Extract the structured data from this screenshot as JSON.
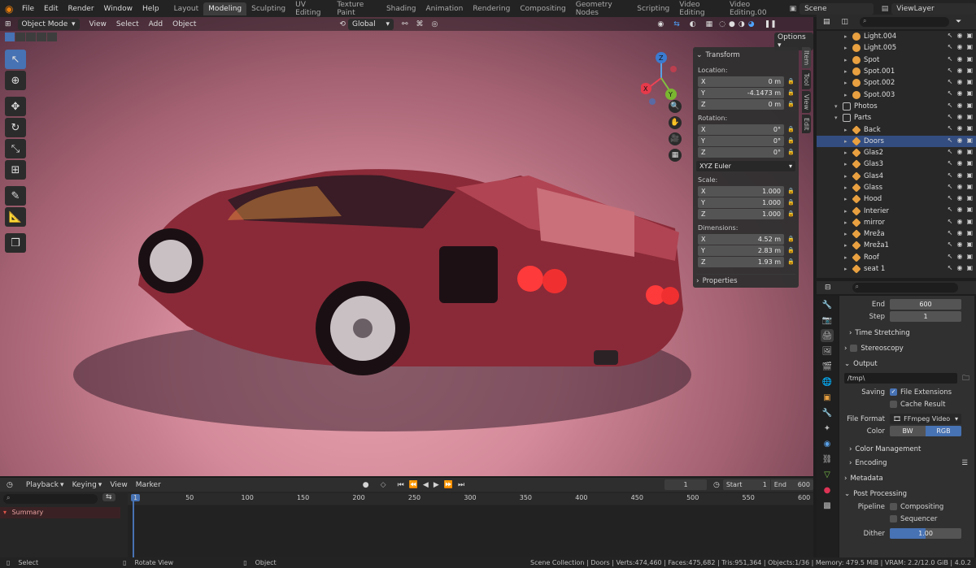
{
  "app": {
    "menu": [
      "File",
      "Edit",
      "Render",
      "Window",
      "Help"
    ],
    "workspaces": [
      "Layout",
      "Modeling",
      "Sculpting",
      "UV Editing",
      "Texture Paint",
      "Shading",
      "Animation",
      "Rendering",
      "Compositing",
      "Geometry Nodes",
      "Scripting",
      "Video Editing",
      "Video Editing.00"
    ],
    "active_workspace": "Modeling",
    "scene": "Scene",
    "view_layer": "ViewLayer"
  },
  "viewport": {
    "mode": "Object Mode",
    "menu": [
      "View",
      "Select",
      "Add",
      "Object"
    ],
    "transform_orientation": "Global",
    "options_label": "Options",
    "side_tabs": [
      "Item",
      "Tool",
      "View",
      "Edit"
    ],
    "gizmo": {
      "x": "X",
      "y": "Y",
      "z": "Z"
    }
  },
  "npanel": {
    "transform_header": "Transform",
    "location_label": "Location:",
    "location": [
      {
        "axis": "X",
        "value": "0 m"
      },
      {
        "axis": "Y",
        "value": "-4.1473 m"
      },
      {
        "axis": "Z",
        "value": "0 m"
      }
    ],
    "rotation_label": "Rotation:",
    "rotation": [
      {
        "axis": "X",
        "value": "0°"
      },
      {
        "axis": "Y",
        "value": "0°"
      },
      {
        "axis": "Z",
        "value": "0°"
      }
    ],
    "rotation_mode": "XYZ Euler",
    "scale_label": "Scale:",
    "scale": [
      {
        "axis": "X",
        "value": "1.000"
      },
      {
        "axis": "Y",
        "value": "1.000"
      },
      {
        "axis": "Z",
        "value": "1.000"
      }
    ],
    "dimensions_label": "Dimensions:",
    "dimensions": [
      {
        "axis": "X",
        "value": "4.52 m"
      },
      {
        "axis": "Y",
        "value": "2.83 m"
      },
      {
        "axis": "Z",
        "value": "1.93 m"
      }
    ],
    "properties_header": "Properties"
  },
  "outliner": {
    "items": [
      {
        "name": "Light.004",
        "kind": "light",
        "indent": 2,
        "selected": false
      },
      {
        "name": "Light.005",
        "kind": "light",
        "indent": 2,
        "selected": false
      },
      {
        "name": "Spot",
        "kind": "light",
        "indent": 2,
        "selected": false
      },
      {
        "name": "Spot.001",
        "kind": "light",
        "indent": 2,
        "selected": false
      },
      {
        "name": "Spot.002",
        "kind": "light",
        "indent": 2,
        "selected": false
      },
      {
        "name": "Spot.003",
        "kind": "light",
        "indent": 2,
        "selected": false
      },
      {
        "name": "Photos",
        "kind": "collection",
        "indent": 1,
        "selected": false
      },
      {
        "name": "Parts",
        "kind": "collection",
        "indent": 1,
        "selected": false
      },
      {
        "name": "Back",
        "kind": "mesh",
        "indent": 2,
        "selected": false
      },
      {
        "name": "Doors",
        "kind": "mesh",
        "indent": 2,
        "selected": true
      },
      {
        "name": "Glas2",
        "kind": "mesh",
        "indent": 2,
        "selected": false
      },
      {
        "name": "Glas3",
        "kind": "mesh",
        "indent": 2,
        "selected": false
      },
      {
        "name": "Glas4",
        "kind": "mesh",
        "indent": 2,
        "selected": false
      },
      {
        "name": "Glass",
        "kind": "mesh",
        "indent": 2,
        "selected": false
      },
      {
        "name": "Hood",
        "kind": "mesh",
        "indent": 2,
        "selected": false
      },
      {
        "name": "Interier",
        "kind": "mesh",
        "indent": 2,
        "selected": false
      },
      {
        "name": "mirror",
        "kind": "mesh",
        "indent": 2,
        "selected": false
      },
      {
        "name": "Mreža",
        "kind": "mesh",
        "indent": 2,
        "selected": false
      },
      {
        "name": "Mreža1",
        "kind": "mesh",
        "indent": 2,
        "selected": false
      },
      {
        "name": "Roof",
        "kind": "mesh",
        "indent": 2,
        "selected": false
      },
      {
        "name": "seat 1",
        "kind": "mesh",
        "indent": 2,
        "selected": false
      }
    ]
  },
  "properties": {
    "end_label": "End",
    "end_value": "600",
    "step_label": "Step",
    "step_value": "1",
    "time_stretching": "Time Stretching",
    "stereoscopy": "Stereoscopy",
    "output": "Output",
    "path": "/tmp\\",
    "saving_label": "Saving",
    "file_extensions": "File Extensions",
    "cache_result": "Cache Result",
    "file_format_label": "File Format",
    "file_format": "FFmpeg Video",
    "color_label": "Color",
    "color_bw": "BW",
    "color_rgb": "RGB",
    "color_management": "Color Management",
    "encoding": "Encoding",
    "metadata": "Metadata",
    "post_processing": "Post Processing",
    "pipeline_label": "Pipeline",
    "compositing": "Compositing",
    "sequencer": "Sequencer",
    "dither_label": "Dither",
    "dither_value": "1.00",
    "dither_fraction": 0.5
  },
  "timeline": {
    "menu": [
      "Playback",
      "Keying",
      "View",
      "Marker"
    ],
    "current_frame": "1",
    "start_label": "Start",
    "start_value": "1",
    "end_label": "End",
    "end_value": "600",
    "ruler": [
      "1",
      "50",
      "100",
      "150",
      "200",
      "250",
      "300",
      "350",
      "400",
      "450",
      "500",
      "550",
      "600"
    ],
    "summary": "Summary"
  },
  "status": {
    "select": "Select",
    "rotate": "Rotate View",
    "object": "Object",
    "stats": "Scene Collection | Doors | Verts:474,460 | Faces:475,682 | Tris:951,364 | Objects:1/36 | Memory: 479.5 MiB | VRAM: 2.2/12.0 GiB | 4.0.2"
  }
}
